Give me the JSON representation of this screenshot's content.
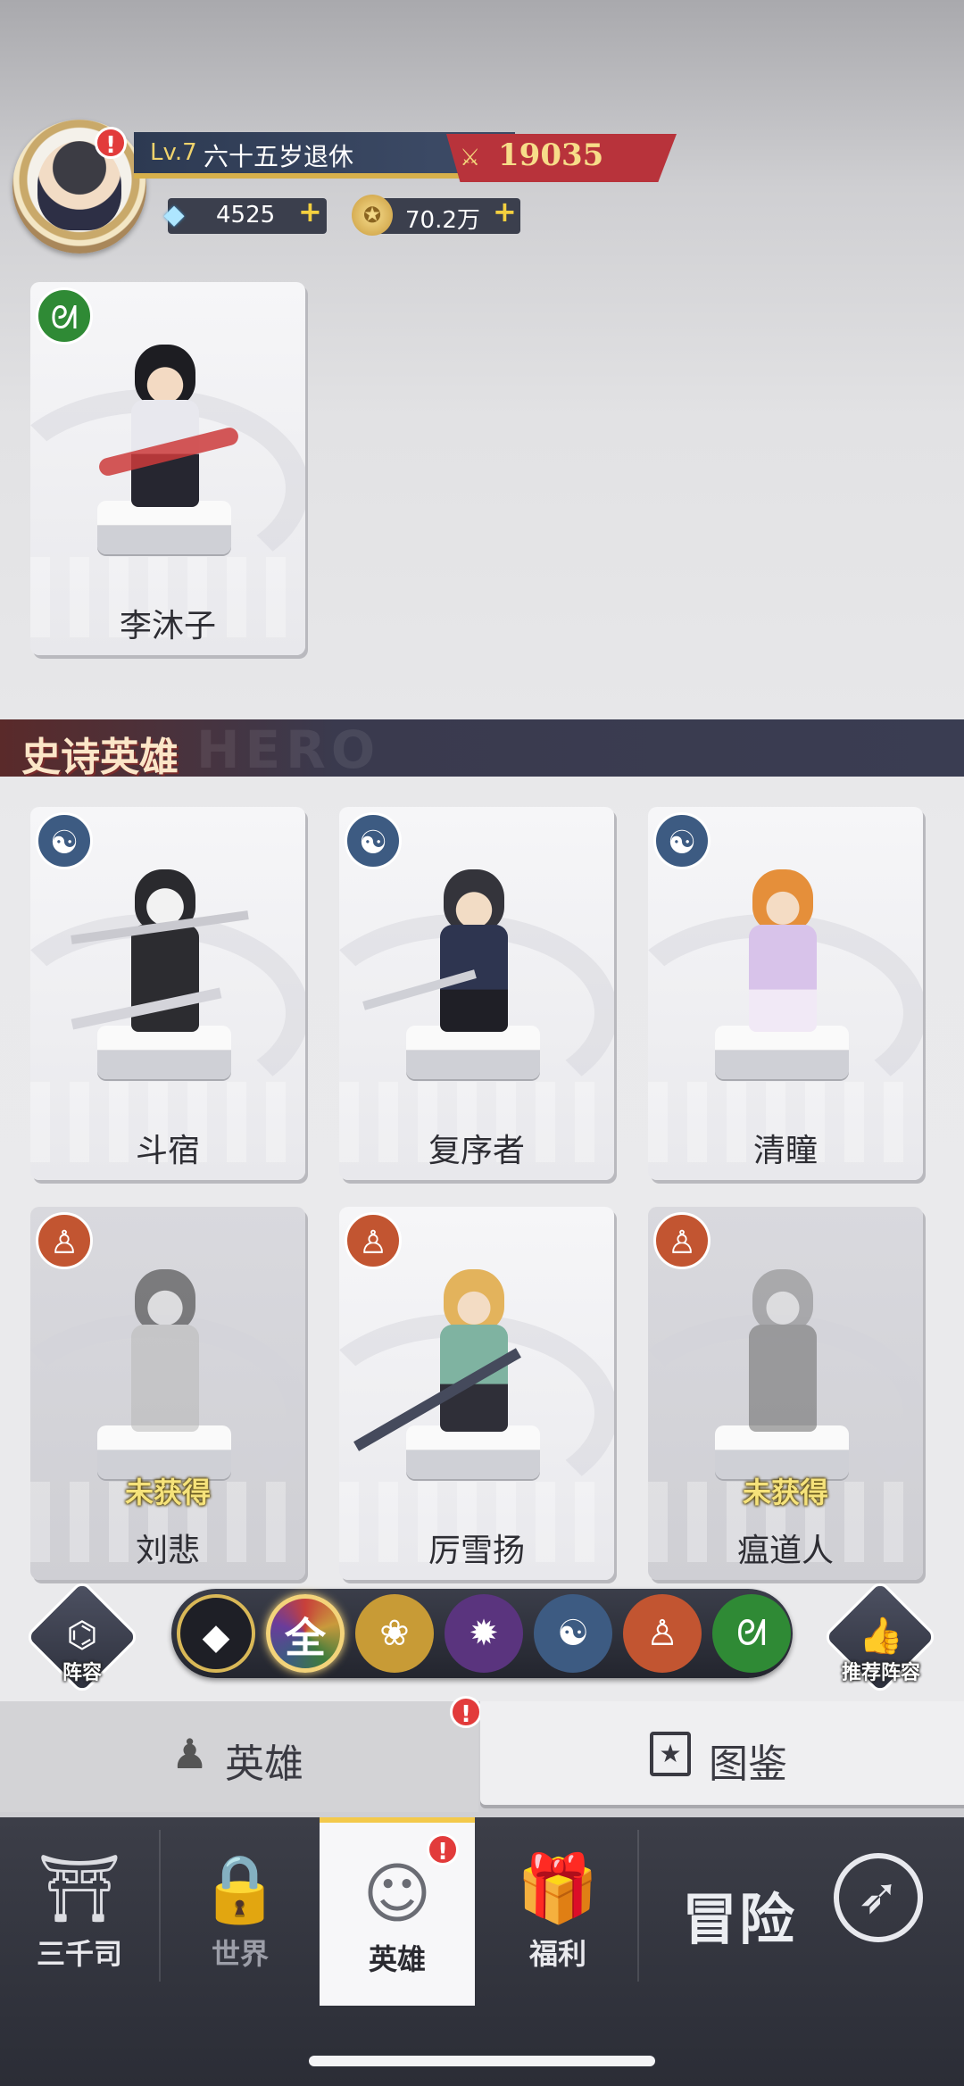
{
  "player": {
    "level": "Lv.7",
    "name": "六十五岁退休",
    "power": "19035",
    "gems": "4525",
    "gold": "70.2万",
    "alert": "!"
  },
  "legendary_heroes": [
    {
      "name": "李沐子",
      "faction": "dna",
      "status": ""
    }
  ],
  "epic_section": {
    "title": "史诗英雄",
    "watermark": "HERO"
  },
  "epic_heroes": [
    {
      "name": "斗宿",
      "faction": "water",
      "status": ""
    },
    {
      "name": "复序者",
      "faction": "water",
      "status": ""
    },
    {
      "name": "清瞳",
      "faction": "water",
      "status": ""
    },
    {
      "name": "刘悲",
      "faction": "monk",
      "status": "未获得"
    },
    {
      "name": "厉雪扬",
      "faction": "monk",
      "status": ""
    },
    {
      "name": "瘟道人",
      "faction": "monk",
      "status": "未获得"
    }
  ],
  "filters": {
    "formation_label": "阵容",
    "recommend_label": "推荐阵容",
    "all_label": "全",
    "options": [
      "all",
      "lotus",
      "flame",
      "water",
      "monk",
      "dna"
    ]
  },
  "sub_tabs": {
    "hero": "英雄",
    "codex": "图鉴"
  },
  "nav": {
    "items": [
      "三千司",
      "世界",
      "英雄",
      "福利"
    ],
    "adventure": "冒险",
    "active": "英雄"
  },
  "colors": {
    "accent_gold": "#f3c94b",
    "power_red": "#b8333b",
    "dna_green": "#2f8a35",
    "water_blue": "#3d5b82",
    "monk_orange": "#c25531"
  }
}
